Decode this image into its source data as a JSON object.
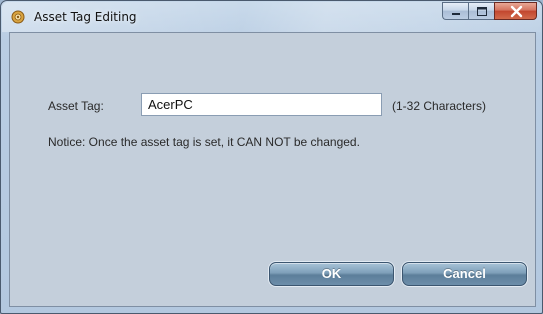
{
  "window": {
    "title": "Asset Tag Editing",
    "icon": "gear-icon"
  },
  "caption_buttons": {
    "minimize": "minimize-icon",
    "maximize": "maximize-icon",
    "close": "close-icon"
  },
  "form": {
    "asset_tag_label": "Asset Tag:",
    "asset_tag_value": "AcerPC",
    "asset_tag_hint": "(1-32 Characters)",
    "notice": "Notice: Once the asset tag is set, it CAN NOT be changed."
  },
  "buttons": {
    "ok_label": "OK",
    "cancel_label": "Cancel"
  },
  "colors": {
    "accent_button": "#6d8eaa",
    "close_button": "#c2462e",
    "client_background": "#c4cfdb"
  }
}
